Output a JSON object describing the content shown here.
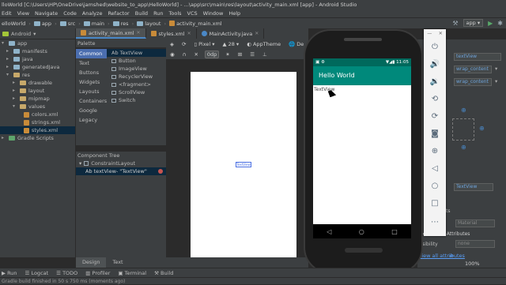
{
  "window": {
    "title": "lloWorld [C:\\Users\\HP\\OneDrive\\jamshed\\website_to_app\\HelloWorld] - ...\\app\\src\\main\\res\\layout\\activity_main.xml [app] - Android Studio"
  },
  "menu": [
    "Edit",
    "View",
    "Navigate",
    "Code",
    "Analyze",
    "Refactor",
    "Build",
    "Run",
    "Tools",
    "VCS",
    "Window",
    "Help"
  ],
  "breadcrumb": [
    "elloWorld",
    "app",
    "src",
    "main",
    "res",
    "layout",
    "activity_main.xml"
  ],
  "toolbar": {
    "run_config": "app"
  },
  "project": {
    "view_mode": "Android",
    "tree": [
      {
        "label": "app",
        "depth": 0,
        "expanded": true
      },
      {
        "label": "manifests",
        "depth": 1
      },
      {
        "label": "java",
        "depth": 1
      },
      {
        "label": "generatedJava",
        "depth": 1
      },
      {
        "label": "res",
        "depth": 1,
        "expanded": true
      },
      {
        "label": "drawable",
        "depth": 2
      },
      {
        "label": "layout",
        "depth": 2
      },
      {
        "label": "mipmap",
        "depth": 2
      },
      {
        "label": "values",
        "depth": 2,
        "expanded": true
      },
      {
        "label": "colors.xml",
        "depth": 3
      },
      {
        "label": "strings.xml",
        "depth": 3
      },
      {
        "label": "styles.xml",
        "depth": 3
      },
      {
        "label": "Gradle Scripts",
        "depth": 0
      }
    ]
  },
  "tabs": [
    {
      "label": "activity_main.xml",
      "active": true
    },
    {
      "label": "styles.xml"
    },
    {
      "label": "MainActivity.java"
    }
  ],
  "palette": {
    "header": "Palette",
    "categories": [
      "Common",
      "Text",
      "Buttons",
      "Widgets",
      "Layouts",
      "Containers",
      "Google",
      "Legacy"
    ],
    "items": [
      "Ab TextView",
      "Button",
      "ImageView",
      "RecyclerView",
      "<fragment>",
      "ScrollView",
      "Switch"
    ]
  },
  "component_tree": {
    "header": "Component Tree",
    "rows": [
      {
        "label": "ConstraintLayout"
      },
      {
        "label": "Ab textView- \"TextView\""
      }
    ]
  },
  "design_toolbar": {
    "device": "Pixel",
    "api": "28",
    "theme": "AppTheme",
    "dp_label": "0dp",
    "truncated": "De"
  },
  "canvas": {
    "selected_label": "TextView"
  },
  "bottom_tabs": [
    "Design",
    "Text"
  ],
  "tool_windows": [
    "Run",
    "Logcat",
    "TODO",
    "Profiler",
    "Terminal",
    "Build"
  ],
  "status": "Gradle build finished in 50 s 750 ms (moments ago)",
  "attributes": {
    "id_value": "textView",
    "width_value": "wrap_content",
    "height_value": "wrap_content",
    "text_value": "TextView",
    "font_label": "ts",
    "text_color_value": "Material",
    "favorites_header": "Favorite Attributes",
    "visibility_label": "visibility",
    "visibility_value": "none",
    "view_all": "View all attributes",
    "zoom_readout": "100%"
  },
  "emulator": {
    "status_time": "11:05",
    "app_title": "Hello World",
    "textview_text": "TextView",
    "buttons": [
      "power-icon",
      "volume-up-icon",
      "volume-down-icon",
      "rotate-left-icon",
      "rotate-right-icon",
      "camera-icon",
      "zoom-icon",
      "back-icon",
      "home-icon",
      "overview-icon",
      "more-icon"
    ]
  }
}
